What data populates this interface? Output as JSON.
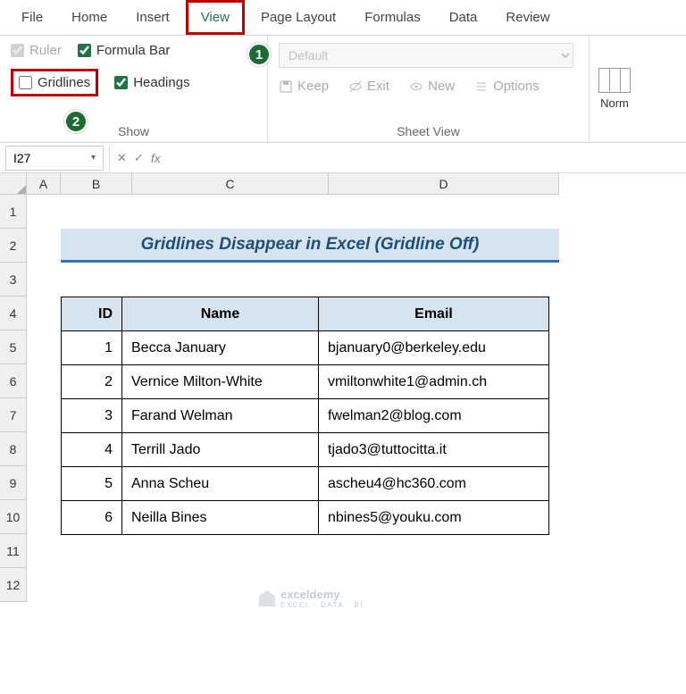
{
  "tabs": [
    "File",
    "Home",
    "Insert",
    "View",
    "Page Layout",
    "Formulas",
    "Data",
    "Review"
  ],
  "active_tab": "View",
  "show_group": {
    "ruler": "Ruler",
    "formula_bar": "Formula Bar",
    "gridlines": "Gridlines",
    "headings": "Headings",
    "label": "Show"
  },
  "sheetview": {
    "default": "Default",
    "keep": "Keep",
    "exit": "Exit",
    "new": "New",
    "options": "Options",
    "label": "Sheet View"
  },
  "right": {
    "normal": "Norm"
  },
  "annotations": {
    "a1": "1",
    "a2": "2"
  },
  "namebox": "I27",
  "fx": "fx",
  "columns": [
    "A",
    "B",
    "C",
    "D"
  ],
  "rows": [
    "1",
    "2",
    "3",
    "4",
    "5",
    "6",
    "7",
    "8",
    "9",
    "10",
    "11",
    "12"
  ],
  "title": "Gridlines Disappear in Excel (Gridline Off)",
  "headers": {
    "id": "ID",
    "name": "Name",
    "email": "Email"
  },
  "data": [
    {
      "id": "1",
      "name": "Becca January",
      "email": "bjanuary0@berkeley.edu"
    },
    {
      "id": "2",
      "name": "Vernice Milton-White",
      "email": "vmiltonwhite1@admin.ch"
    },
    {
      "id": "3",
      "name": "Farand Welman",
      "email": "fwelman2@blog.com"
    },
    {
      "id": "4",
      "name": "Terrill Jado",
      "email": "tjado3@tuttocitta.it"
    },
    {
      "id": "5",
      "name": "Anna Scheu",
      "email": "ascheu4@hc360.com"
    },
    {
      "id": "6",
      "name": "Neilla Bines",
      "email": "nbines5@youku.com"
    }
  ],
  "watermark": {
    "name": "exceldemy",
    "sub": "EXCEL · DATA · BI"
  }
}
